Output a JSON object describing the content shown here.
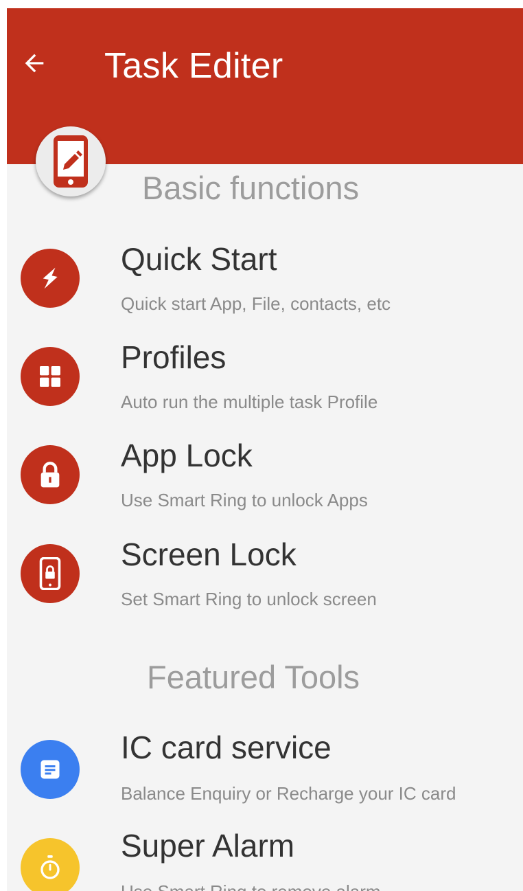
{
  "appbar": {
    "title": "Task Editer",
    "back_icon": "arrow-left-icon",
    "badge_icon": "tablet-edit-icon"
  },
  "colors": {
    "primary": "#c0301c",
    "background": "#f4f4f4",
    "blue_accent": "#3b7ff0",
    "yellow_accent": "#f6c42c"
  },
  "sections": [
    {
      "title": "Basic functions",
      "items": [
        {
          "title": "Quick Start",
          "subtitle": "Quick start App, File, contacts, etc",
          "icon": "lightning-icon"
        },
        {
          "title": "Profiles",
          "subtitle": "Auto run the multiple task Profile",
          "icon": "grid-icon"
        },
        {
          "title": "App Lock",
          "subtitle": "Use Smart Ring to unlock Apps",
          "icon": "padlock-icon"
        },
        {
          "title": "Screen Lock",
          "subtitle": "Set Smart Ring to unlock screen",
          "icon": "phone-lock-icon"
        }
      ]
    },
    {
      "title": "Featured Tools",
      "items": [
        {
          "title": "IC card service",
          "subtitle": "Balance Enquiry or Recharge your IC card",
          "icon": "card-document-icon"
        },
        {
          "title": "Super Alarm",
          "subtitle": "Use Smart Ring to remove alarm",
          "icon": "stopwatch-icon"
        }
      ]
    }
  ]
}
